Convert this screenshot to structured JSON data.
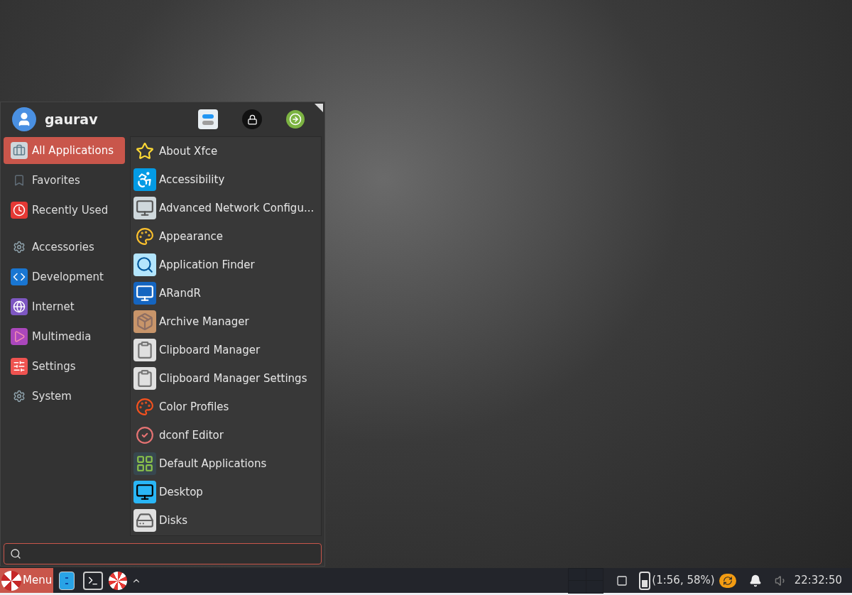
{
  "menu": {
    "user": "gaurav",
    "categories": [
      {
        "label": "All Applications",
        "selected": true
      },
      {
        "label": "Favorites",
        "selected": false
      },
      {
        "label": "Recently Used",
        "selected": false
      },
      {
        "label": "Accessories",
        "selected": false
      },
      {
        "label": "Development",
        "selected": false
      },
      {
        "label": "Internet",
        "selected": false
      },
      {
        "label": "Multimedia",
        "selected": false
      },
      {
        "label": "Settings",
        "selected": false
      },
      {
        "label": "System",
        "selected": false
      }
    ],
    "apps": [
      "About Xfce",
      "Accessibility",
      "Advanced Network Configu...",
      "Appearance",
      "Application Finder",
      "ARandR",
      "Archive Manager",
      "Clipboard Manager",
      "Clipboard Manager Settings",
      "Color Profiles",
      "dconf Editor",
      "Default Applications",
      "Desktop",
      "Disks"
    ]
  },
  "taskbar": {
    "menu_label": "Menu",
    "battery": "(1:56, 58%)",
    "clock": "22:32:50"
  }
}
